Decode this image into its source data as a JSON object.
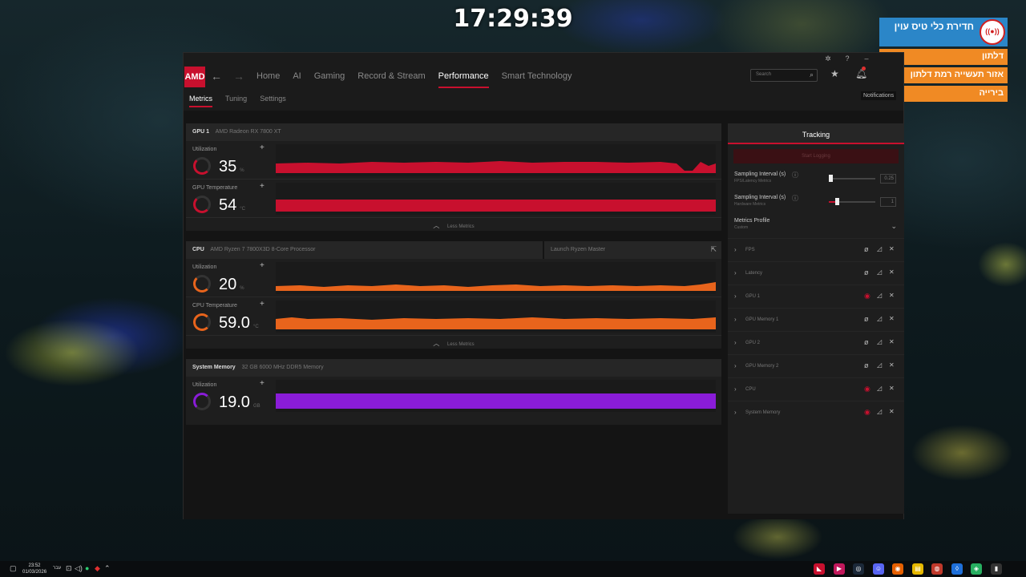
{
  "overlay": {
    "clock": "17:29:39"
  },
  "window": {
    "nav": {
      "logo_text": "AMD",
      "back_icon": "arrow-left-icon",
      "forward_icon": "arrow-right-icon",
      "items": [
        "Home",
        "AI",
        "Gaming",
        "Record & Stream",
        "Performance",
        "Smart Technology"
      ],
      "active": "Performance",
      "search_placeholder": "Search",
      "tooltip": "Notifications"
    },
    "subnav": {
      "items": [
        "Metrics",
        "Tuning",
        "Settings"
      ],
      "active": "Metrics"
    },
    "gpu": {
      "type": "GPU 1",
      "name": "AMD Radeon RX 7800 XT",
      "metrics": [
        {
          "label": "Utilization",
          "value": "35",
          "unit": "%",
          "color": "#c8102e"
        },
        {
          "label": "GPU Temperature",
          "value": "54",
          "unit": "°C",
          "color": "#c8102e"
        }
      ],
      "less_label": "Less Metrics"
    },
    "cpu": {
      "type": "CPU",
      "name": "AMD Ryzen 7 7800X3D 8-Core Processor",
      "launch_label": "Launch Ryzen Master",
      "metrics": [
        {
          "label": "Utilization",
          "value": "20",
          "unit": "%",
          "color": "#e8641c"
        },
        {
          "label": "CPU Temperature",
          "value": "59.0",
          "unit": "°C",
          "color": "#e8641c"
        }
      ],
      "less_label": "Less Metrics"
    },
    "memory": {
      "type": "System Memory",
      "name": "32 GB 6000 MHz DDR5 Memory",
      "metrics": [
        {
          "label": "Utilization",
          "value": "19.0",
          "unit": "GB",
          "color": "#8a1cd8"
        }
      ]
    },
    "tracking": {
      "title": "Tracking",
      "start_logging": "Start Logging",
      "sampling_fps": {
        "label": "Sampling Interval (s)",
        "sub": "FPS/Latency Metrics",
        "value": "0.25"
      },
      "sampling_hw": {
        "label": "Sampling Interval (s)",
        "sub": "Hardware Metrics",
        "value": "1"
      },
      "profile": {
        "label": "Metrics Profile",
        "sub": "Custom"
      },
      "rows": [
        {
          "name": "FPS",
          "eye_red": false
        },
        {
          "name": "Latency",
          "eye_red": false
        },
        {
          "name": "GPU 1",
          "eye_red": true
        },
        {
          "name": "GPU Memory 1",
          "eye_red": false
        },
        {
          "name": "GPU 2",
          "eye_red": false
        },
        {
          "name": "GPU Memory 2",
          "eye_red": false
        },
        {
          "name": "CPU",
          "eye_red": true
        },
        {
          "name": "System Memory",
          "eye_red": true
        }
      ]
    }
  },
  "news": {
    "title": "חדירת כלי טיס עוין",
    "items": [
      "דלתון",
      "אזור תעשייה רמת דלתון",
      "בירייה"
    ]
  },
  "taskbar": {
    "time": "23:52",
    "date": "01/03/2026",
    "lang": "עבר"
  }
}
